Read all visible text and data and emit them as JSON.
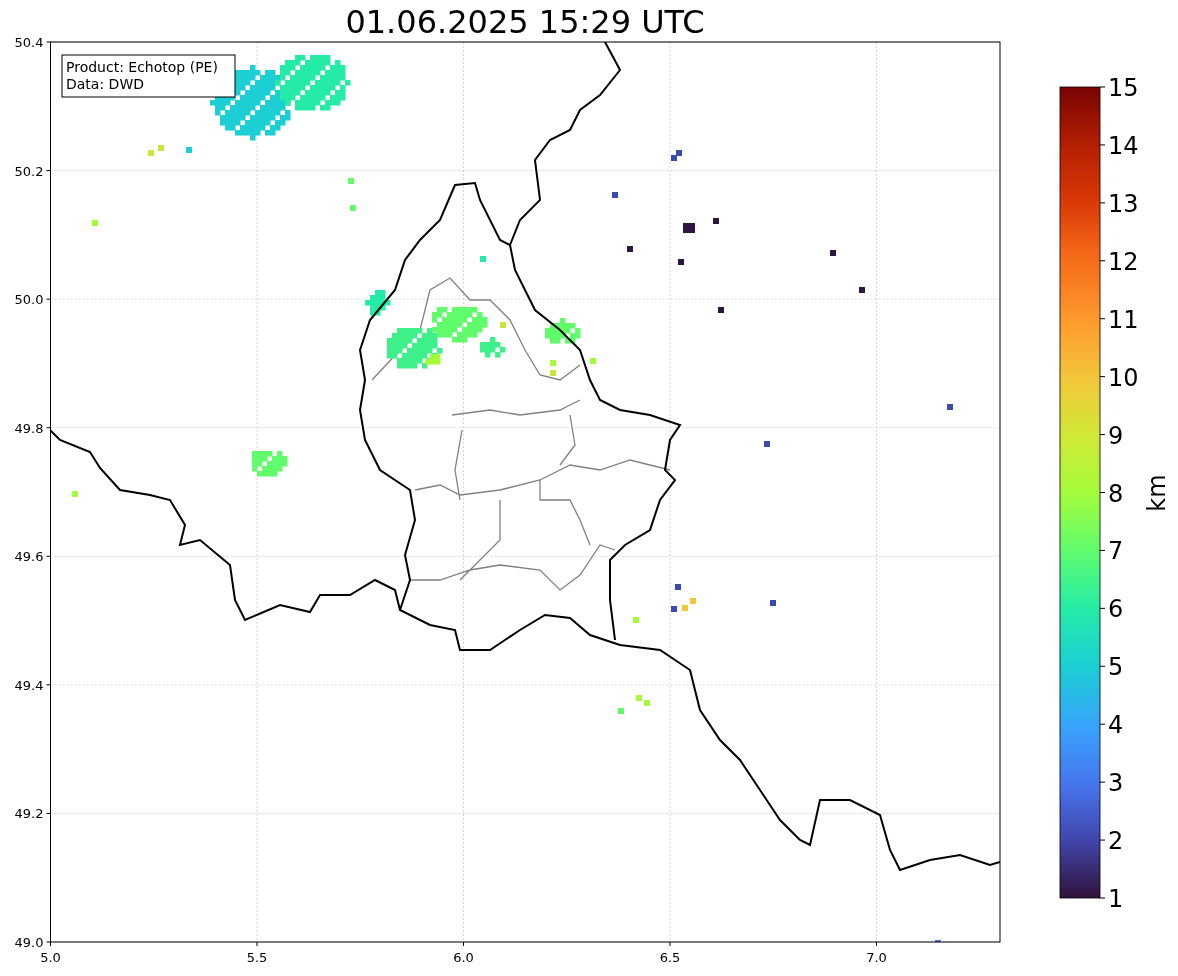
{
  "title": "01.06.2025 15:29 UTC",
  "info_box": [
    "Product: Echotop (PE)",
    "Data: DWD"
  ],
  "x_ticks": [
    "5.0",
    "5.5",
    "6.0",
    "6.5",
    "7.0"
  ],
  "y_ticks": [
    "50.4",
    "50.2",
    "50.0",
    "49.8",
    "49.6",
    "49.4",
    "49.2",
    "49.0"
  ],
  "colorbar": {
    "ticks": [
      "15",
      "14",
      "13",
      "12",
      "11",
      "10",
      "9",
      "8",
      "7",
      "6",
      "5",
      "4",
      "3",
      "2",
      "1"
    ],
    "label": "km"
  }
}
